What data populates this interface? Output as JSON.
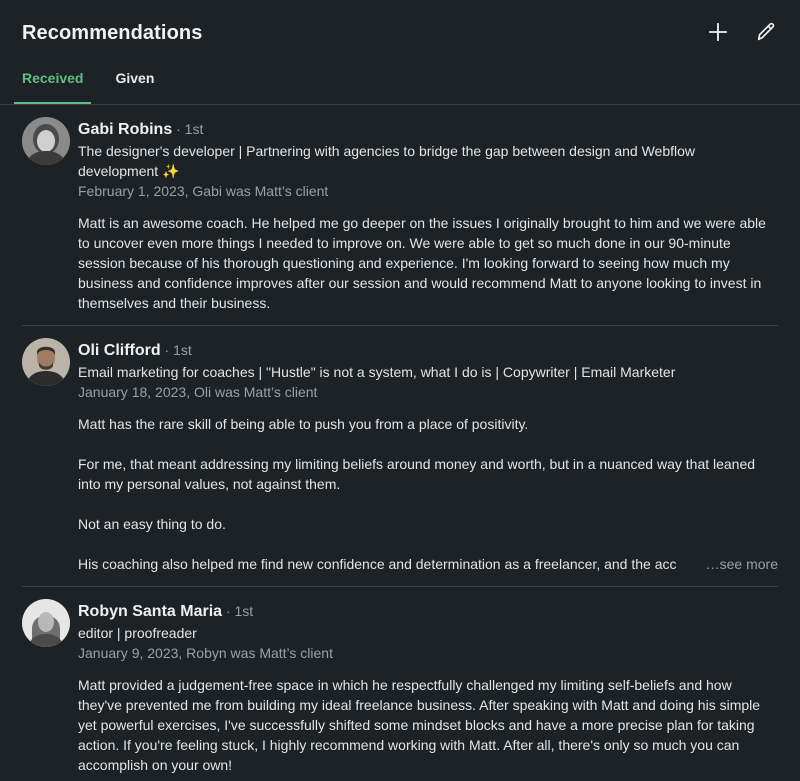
{
  "header": {
    "title": "Recommendations",
    "add_icon": "plus-icon",
    "edit_icon": "pencil-icon"
  },
  "tabs": [
    {
      "label": "Received",
      "active": true
    },
    {
      "label": "Given",
      "active": false
    }
  ],
  "colors": {
    "background": "#1d2226",
    "accent": "#5fbd88",
    "muted": "#9aa0a6",
    "divider": "#3a3f44"
  },
  "recommendations": [
    {
      "name": "Gabi Robins",
      "degree": " · 1st",
      "headline_line1": "The designer's developer | Partnering with agencies to bridge the gap between design and Webflow",
      "headline_line2": "development ✨",
      "meta": "February 1, 2023, Gabi was Matt’s client",
      "paragraphs": [
        "Matt is an awesome coach. He helped me go deeper on the issues I originally brought to him and we were able to uncover even more things I needed to improve on. We were able to get so much done in our 90-minute session because of his thorough questioning and experience. I'm looking forward to seeing how much my business and confidence improves after our session and would recommend Matt to anyone looking to invest in themselves and their business."
      ]
    },
    {
      "name": "Oli Clifford",
      "degree": " · 1st",
      "headline": "Email marketing for coaches | \"Hustle\" is not a system, what I do is | Copywriter | Email Marketer",
      "meta": "January 18, 2023, Oli was Matt’s client",
      "paragraphs": [
        "Matt has the rare skill of being able to push you from a place of positivity.",
        "For me, that meant addressing my limiting beliefs around money and worth, but in a nuanced way that leaned into my personal values, not against them.",
        "Not an easy thing to do."
      ],
      "truncated_line": "His coaching also helped me find new confidence and determination as a freelancer, and the acc",
      "see_more": "…see more"
    },
    {
      "name": "Robyn Santa Maria",
      "degree": " · 1st",
      "headline": "editor | proofreader",
      "meta": "January 9, 2023, Robyn was Matt’s client",
      "paragraphs": [
        "Matt provided a judgement-free space in which he respectfully challenged my limiting self-beliefs and how they've prevented me from building my ideal freelance business. After speaking with Matt and doing his simple yet powerful exercises, I've successfully shifted some mindset blocks and have a more precise plan for taking action. If you're feeling stuck, I highly recommend working with Matt. After all, there's only so much you can accomplish on your own!"
      ]
    }
  ]
}
